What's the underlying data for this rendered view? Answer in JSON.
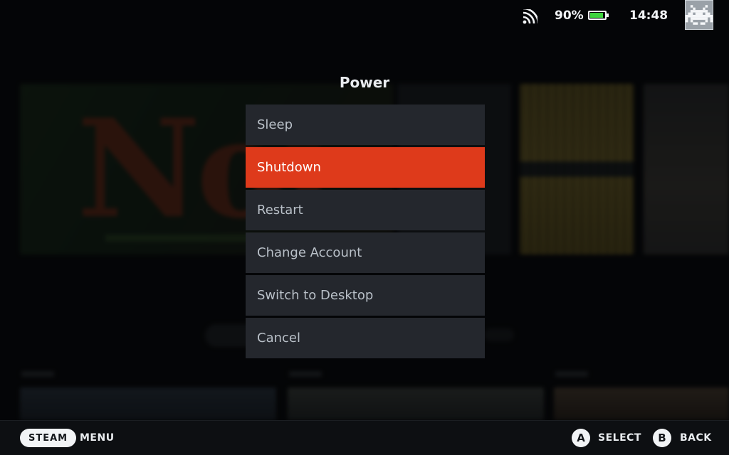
{
  "status_bar": {
    "battery_percent_text": "90%",
    "battery_level": 0.9,
    "battery_color": "#3dd43d",
    "time": "14:48",
    "wifi_icon": "wifi-icon",
    "avatar_icon": "space-invader-avatar-icon"
  },
  "dialog": {
    "title": "Power",
    "selected_index": 1,
    "accent_color": "#de3a1b",
    "items": [
      {
        "label": "Sleep"
      },
      {
        "label": "Shutdown"
      },
      {
        "label": "Restart"
      },
      {
        "label": "Change Account"
      },
      {
        "label": "Switch to Desktop"
      },
      {
        "label": "Cancel"
      }
    ]
  },
  "footer": {
    "steam_label": "STEAM",
    "menu_label": "MENU",
    "a_glyph": "A",
    "select_label": "SELECT",
    "b_glyph": "B",
    "back_label": "BACK"
  }
}
